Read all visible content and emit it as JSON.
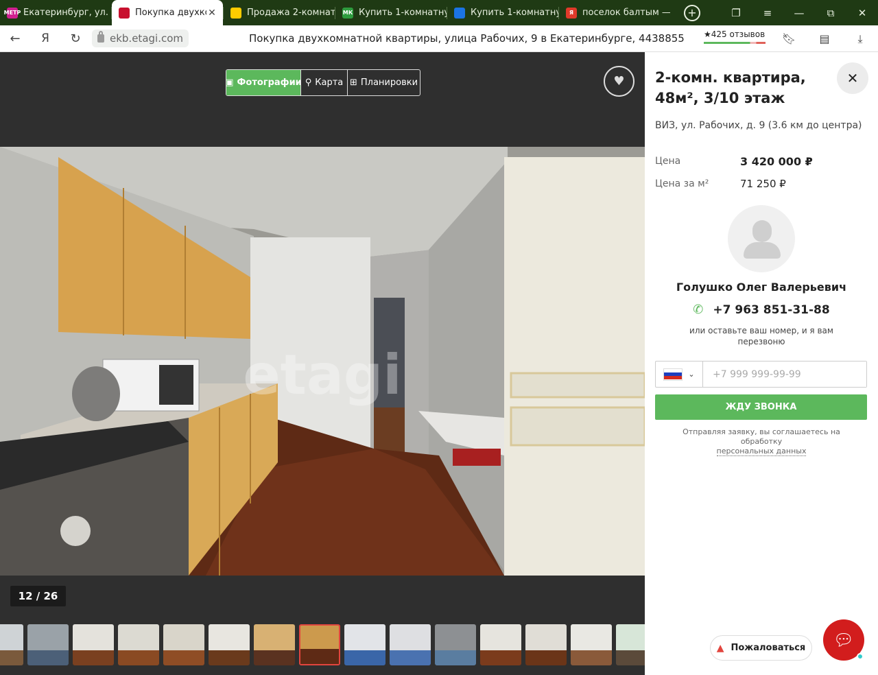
{
  "browser": {
    "tabs": [
      {
        "title": "Екатеринбург, ул. Р",
        "favicon_text": "МЕТР",
        "favicon_color": "#d02090",
        "active": false
      },
      {
        "title": "Покупка двухком",
        "favicon_text": "",
        "favicon_color": "#c8102e",
        "active": true
      },
      {
        "title": "Продажа 2-комнат",
        "favicon_text": "",
        "favicon_color": "#ffcc00",
        "active": false
      },
      {
        "title": "Купить 1-комнатну",
        "favicon_text": "МК",
        "favicon_color": "#2e9c3e",
        "active": false
      },
      {
        "title": "Купить 1-комнатну",
        "favicon_text": "",
        "favicon_color": "#1b74e4",
        "active": false
      },
      {
        "title": "поселок балтым —",
        "favicon_text": "Я",
        "favicon_color": "#e03a2a",
        "active": false
      }
    ],
    "url": "ekb.etagi.com",
    "page_title": "Покупка двухкомнатной квартиры, улица Рабочих, 9 в Екатеринбурге, 4438855",
    "reviews": "★425 отзывов",
    "browser_logo": "Я",
    "tab_close": "✕",
    "new_tab": "+"
  },
  "gallery": {
    "tabs": {
      "photos": "Фотографии",
      "map": "Карта",
      "plans": "Планировки"
    },
    "counter": "12 / 26",
    "watermark": "etagi",
    "thumbnail_count": 15,
    "selected_thumbnail_index": 7
  },
  "listing": {
    "title": "2-комн. квартира, 48м², 3/10 этаж",
    "address": "ВИЗ, ул. Рабочих, д. 9 (3.6 км до центра)",
    "price_label": "Цена",
    "price": "3 420 000 ₽",
    "price_per_m2_label": "Цена за м²",
    "price_per_m2": "71 250 ₽"
  },
  "agent": {
    "name": "Голушко Олег Валерьевич",
    "phone": "+7 963 851-31-88",
    "callback_hint": "или оставьте ваш номер, и я вам перезвоню"
  },
  "form": {
    "phone_placeholder": "+7 999 999-99-99",
    "submit_label": "ЖДУ ЗВОНКА",
    "consent_text": "Отправляя заявку, вы соглашаетесь на обработку",
    "consent_link": "персональных данных"
  },
  "actions": {
    "complain_label": "Пожаловаться"
  },
  "colors": {
    "accent_green": "#5cb85c",
    "chat_red": "#d21d1d",
    "tabbar_bg": "#1f3a14"
  }
}
